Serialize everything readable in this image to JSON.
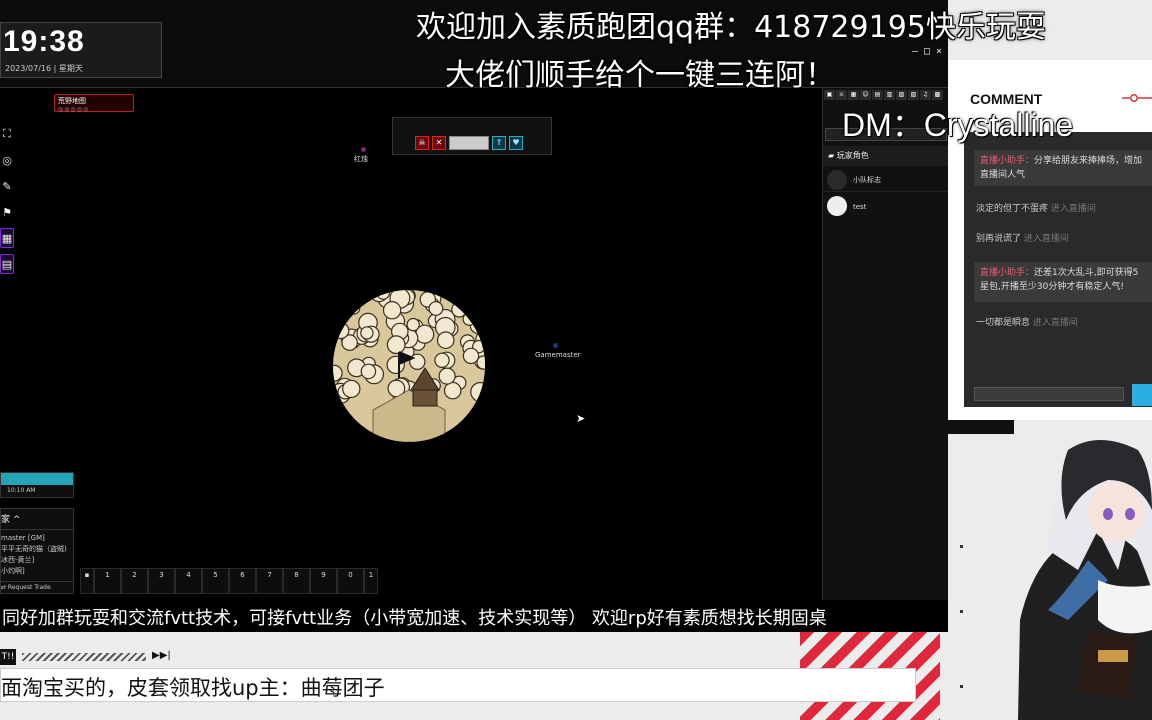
{
  "stream": {
    "clock_time": "19:38",
    "clock_date": "2023/07/16 | 星期天",
    "caption_top": "欢迎加入素质跑团qq群：418729195快乐玩耍",
    "caption_second": "大佬们顺手给个一键三连阿！",
    "dm_label": "DM：Crystalline",
    "ticker": "同好加群玩耍和交流fvtt技术，可接fvtt业务（小带宽加速、技术实现等） 欢迎rp好有素质想找长期固桌",
    "notice_tag": "T!!",
    "notice_play": "▶▶|",
    "subtitle": "面淘宝买的，皮套领取找up主：曲莓团子"
  },
  "vtt": {
    "scene_name": "荒野地图",
    "scene_dots": "◎◎◎◎◎",
    "controls": [
      "⛶",
      "◎",
      "✎",
      "⚑",
      "▦",
      "▤"
    ],
    "tokens": [
      {
        "name": "红烛",
        "color": "#7a2a7a"
      },
      {
        "name": "Gamemaster",
        "color": "#223a7a"
      }
    ],
    "time_widget": {
      "time": "10:10 AM"
    },
    "players": {
      "header": "家 ^",
      "list": [
        "master [GM]",
        "平平无奇的猫（盗贼)",
        "冰西-黄兰]",
        "小灼啊]"
      ],
      "request_trade": "⇄ Request Trade"
    },
    "hotbar": {
      "slots": [
        "1",
        "2",
        "3",
        "4",
        "5",
        "6",
        "7",
        "8",
        "9",
        "0"
      ],
      "page": "1"
    },
    "sidebar": {
      "folder": "玩家角色",
      "actors": [
        {
          "name": "小队标志"
        },
        {
          "name": "test"
        }
      ]
    }
  },
  "comments": {
    "title": "COMMENT",
    "messages": [
      {
        "user": "直播小助手",
        "text": "分享给朋友来捧捧场，增加直播间人气",
        "system": true
      },
      {
        "user": "淡定的但丁不蛋疼",
        "text": "进入直播间",
        "system": false
      },
      {
        "user": "别再说谎了",
        "text": "进入直播间",
        "system": false
      },
      {
        "user": "直播小助手",
        "text": "还差1次大乱斗,即可获得5星包,开播至少30分钟才有稳定人气!",
        "system": true
      },
      {
        "user": "一切都是瞬息",
        "text": "进入直播间",
        "system": false
      }
    ]
  },
  "colors": {
    "accent_red": "#d22828",
    "accent_cyan": "#2caee0",
    "accent_purple": "#7a30d0",
    "ticker_bg": "#000000"
  }
}
